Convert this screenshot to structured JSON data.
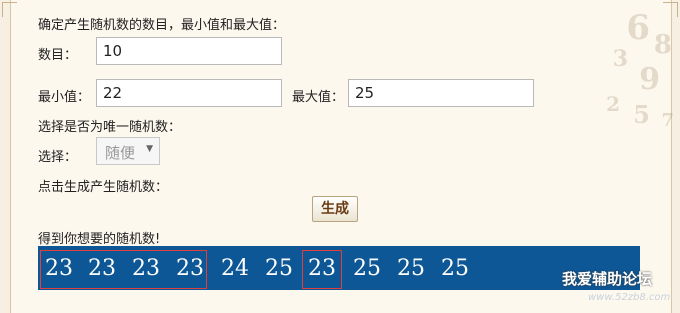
{
  "intro": "确定产生随机数的数目，最小值和最大值：",
  "count": {
    "label": "数目：",
    "value": "10"
  },
  "min": {
    "label": "最小值：",
    "value": "22"
  },
  "max": {
    "label": "最大值：",
    "value": "25"
  },
  "unique_prompt": "选择是否为唯一随机数：",
  "select": {
    "label": "选择：",
    "value": "随便"
  },
  "generate_prompt": "点击生成产生随机数：",
  "generate_button": "生成",
  "result_title": "得到你想要的随机数!",
  "results": [
    "23",
    "23",
    "23",
    "23",
    "24",
    "25",
    "23",
    "25",
    "25",
    "25"
  ],
  "watermark": "我爱辅助论坛",
  "watermark_url": "www.52zb8.com",
  "colors": {
    "result_bg": "#0d5796",
    "highlight": "#e0403a",
    "button_text": "#6a3a12"
  }
}
